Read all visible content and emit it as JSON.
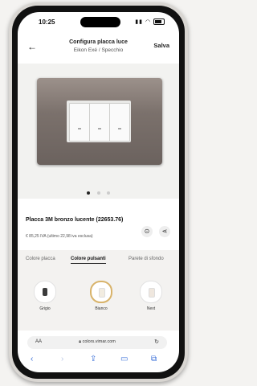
{
  "status": {
    "time": "10:25"
  },
  "nav": {
    "back_icon": "chevron-left",
    "title": "Configura placca luce",
    "subtitle": "Eikon Exé / Specchio",
    "save_label": "Salva"
  },
  "gallery": {
    "page_count": 3,
    "active_page": 1
  },
  "product": {
    "name": "Placca 3M bronzo lucente (22653.76)",
    "price": "€ 85,25 IVA (ultimo 22,98 iva esclusa)",
    "info_icon": "info-icon",
    "share_icon": "share-icon"
  },
  "tabs": [
    {
      "label": "Colore placca"
    },
    {
      "label": "Colore pulsanti"
    },
    {
      "label": "Parete di sfondo"
    }
  ],
  "active_tab": 1,
  "swatches": [
    {
      "label": "Grigio",
      "color": "#3b3b3b"
    },
    {
      "label": "Bianco",
      "color": "#f2ece0"
    },
    {
      "label": "Next",
      "color": "#efe7de"
    }
  ],
  "selected_swatch": 1,
  "browser": {
    "aa_label": "AA",
    "url": "colors.vimar.com"
  },
  "colors": {
    "selected_ring": "#d8b36a",
    "link_blue": "#3a6fd8"
  }
}
